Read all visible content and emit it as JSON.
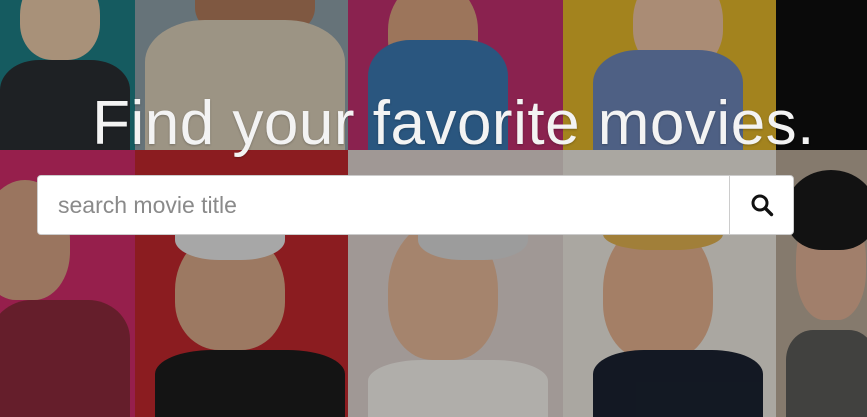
{
  "hero": {
    "title": "Find your favorite movies."
  },
  "search": {
    "placeholder": "search movie title",
    "value": "",
    "button_icon": "search-icon"
  },
  "colors": {
    "title_text": "#f3f3f3",
    "input_bg": "#ffffff",
    "placeholder": "#8a8a8a",
    "icon": "#111111"
  }
}
